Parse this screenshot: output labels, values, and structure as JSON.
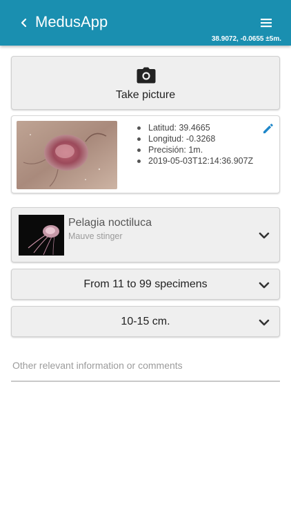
{
  "appbar": {
    "title": "MedusApp",
    "gps_readout": "38.9072, -0.0655 ±5m.",
    "color": "#1a8fb0"
  },
  "take_picture": {
    "label": "Take picture",
    "icon": "camera-icon"
  },
  "photo": {
    "latitude": "Latitud: 39.4665",
    "longitude": "Longitud: -0.3268",
    "precision": "Precisión: 1m.",
    "timestamp": "2019-05-03T12:14:36.907Z",
    "edit_icon": "pencil-icon",
    "accent": "#1f87c9"
  },
  "species": {
    "name": "Pelagia noctiluca",
    "common_name": "Mauve stinger"
  },
  "specimen_count": {
    "selected": "From 11 to 99 specimens"
  },
  "size": {
    "selected": "10-15 cm."
  },
  "comments": {
    "placeholder": "Other relevant information or comments",
    "value": ""
  }
}
